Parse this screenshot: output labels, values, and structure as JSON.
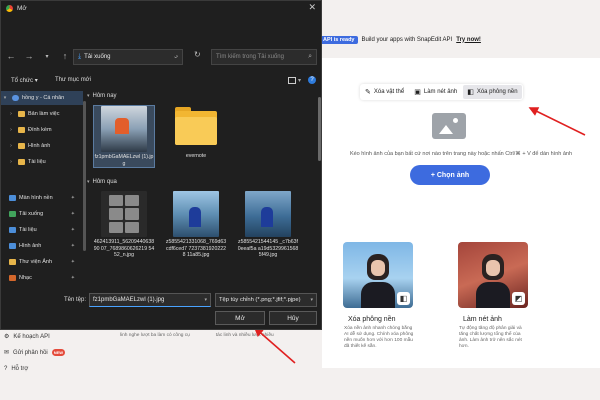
{
  "dialog": {
    "title": "Mở",
    "close_icon": "close-icon",
    "nav": {
      "back_icon": "arrow-left-icon",
      "forward_icon": "arrow-right-icon",
      "dropdown_icon": "chevron-down-icon",
      "up_icon": "arrow-up-icon",
      "path": "Tải xuống",
      "path_chevron": "›",
      "search_placeholder": "Tìm kiếm trong Tải xuống"
    },
    "toolbar": {
      "organize": "Tổ chức ▾",
      "new_folder": "Thư mục mới"
    },
    "sidebar": {
      "items": [
        {
          "label": "hồng y - Cá nhân",
          "icon": "cloud-icon",
          "expander": "▾",
          "selected": true
        },
        {
          "label": "Bản làm việc",
          "icon": "folder-icon",
          "expander": "›"
        },
        {
          "label": "Đính kèm",
          "icon": "folder-icon",
          "expander": "›"
        },
        {
          "label": "Hình ảnh",
          "icon": "folder-icon",
          "expander": "›"
        },
        {
          "label": "Tài liệu",
          "icon": "folder-icon",
          "expander": "›"
        },
        {
          "label": "Màn hình nền",
          "icon": "desktop-icon",
          "pinned": true
        },
        {
          "label": "Tải xuống",
          "icon": "download-icon",
          "pinned": true
        },
        {
          "label": "Tài liệu",
          "icon": "document-icon",
          "pinned": true
        },
        {
          "label": "Hình ảnh",
          "icon": "image-icon",
          "pinned": true
        },
        {
          "label": "Thư viện Ảnh",
          "icon": "folder-icon",
          "pinned": true
        },
        {
          "label": "Nhạc",
          "icon": "music-icon",
          "pinned": true
        }
      ]
    },
    "groups": {
      "today": "Hôm nay",
      "yesterday": "Hôm qua"
    },
    "files_today": [
      {
        "name": "fz1pmbGaMAELzwl (1).jpg",
        "kind": "pc",
        "selected": true
      },
      {
        "name": "evernote",
        "kind": "folder"
      }
    ],
    "files_yesterday": [
      {
        "name": "462413911_5620944063890 07_7689860626219 5452_n.jpg",
        "kind": "grid"
      },
      {
        "name": "z5855421331068_769d63cdf6ced7 72373819202228 11a85.jpg",
        "kind": "photo1"
      },
      {
        "name": "z5855421544145 _c7b63f0eeaf5a a19d5329961568 5f49.jpg",
        "kind": "photo2"
      }
    ],
    "bottom": {
      "filename_label": "Tên tệp:",
      "filename_value": "fz1pmbGaMAELzwl (1).jpg",
      "filetype_value": "Tệp tùy chỉnh (*.png;*.jfif;*.pjpe)",
      "open": "Mở",
      "cancel": "Hủy"
    }
  },
  "web": {
    "banner": {
      "tag": "API is ready",
      "text": "Build your apps with SnapEdit API",
      "link": "Try now!"
    },
    "tabs": [
      {
        "label": "Xóa vật thể",
        "icon": "eraser-icon"
      },
      {
        "label": "Làm nét ảnh",
        "icon": "sharpen-icon"
      },
      {
        "label": "Xóa phông nền",
        "icon": "background-remove-icon",
        "active": true
      }
    ],
    "upload_hint": "Kéo hình ảnh của bạn bất cứ nơi nào trên trang này hoặc nhấn Ctrl/⌘ + V để dán hình ảnh",
    "choose_button": "+ Chọn ảnh",
    "cards": [
      {
        "title": "Xóa phông nền",
        "desc": "Xóa nền ảnh nhanh chóng bằng AI dễ sử dụng. Chính xóa phông nền muốn hơn với hơn 100 mẫu đã thiết kế sẵn."
      },
      {
        "title": "Làm nét ảnh",
        "desc": "Tự động tăng độ phân giải và tăng chất lượng tổng thể của ảnh. Làm ảnh trở nên sắc nét hơn."
      }
    ],
    "under_desc": [
      "linh nghe lượt ba làm có công cụ",
      "tác linh và nhiều lượt nhiều"
    ],
    "left_nav": [
      {
        "label": "Kế hoạch API",
        "icon": "api-icon"
      },
      {
        "label": "Gửi phản hồi",
        "icon": "feedback-icon",
        "badge": "NEW"
      },
      {
        "label": "Hỗ trợ",
        "icon": "help-icon"
      }
    ],
    "accent": "#3d6bdf",
    "arrow_color": "#e02020"
  }
}
